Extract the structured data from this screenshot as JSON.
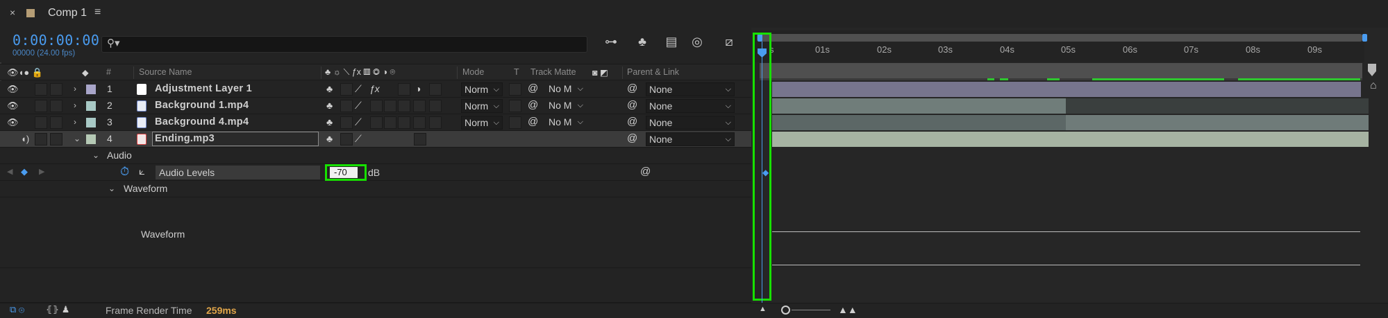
{
  "tab": {
    "close": "×",
    "title": "Comp 1",
    "menu": "≡"
  },
  "header": {
    "timecode": "0:00:00:00",
    "fps": "00000 (24.00 fps)",
    "search_placeholder": ""
  },
  "columns": {
    "hash": "#",
    "source_name": "Source Name",
    "mode": "Mode",
    "t": "T",
    "track_matte": "Track Matte",
    "parent_link": "Parent & Link"
  },
  "layers": [
    {
      "num": "1",
      "name": "Adjustment Layer 1",
      "label_color": "#a8a5c9",
      "mode": "Norm",
      "matte": "No M",
      "parent": "None"
    },
    {
      "num": "2",
      "name": "Background 1.mp4",
      "label_color": "#a8c9c5",
      "mode": "Norm",
      "matte": "No M",
      "parent": "None"
    },
    {
      "num": "3",
      "name": "Background 4.mp4",
      "label_color": "#a8c9c5",
      "mode": "Norm",
      "matte": "No M",
      "parent": "None"
    },
    {
      "num": "4",
      "name": "Ending.mp3",
      "label_color": "#b5c9b5",
      "parent": "None"
    }
  ],
  "properties": {
    "audio_group": "Audio",
    "audio_levels_label": "Audio Levels",
    "audio_levels_value": "-70",
    "audio_levels_unit": "dB",
    "waveform_group": "Waveform",
    "waveform_label": "Waveform"
  },
  "ruler": {
    "ticks": [
      "s",
      "01s",
      "02s",
      "03s",
      "04s",
      "05s",
      "06s",
      "07s",
      "08s",
      "09s"
    ]
  },
  "footer": {
    "label": "Frame Render Time",
    "value": "259ms"
  },
  "colors": {
    "accent": "#4a9cf0",
    "highlight": "#17e000",
    "render_time": "#e2a64a"
  }
}
